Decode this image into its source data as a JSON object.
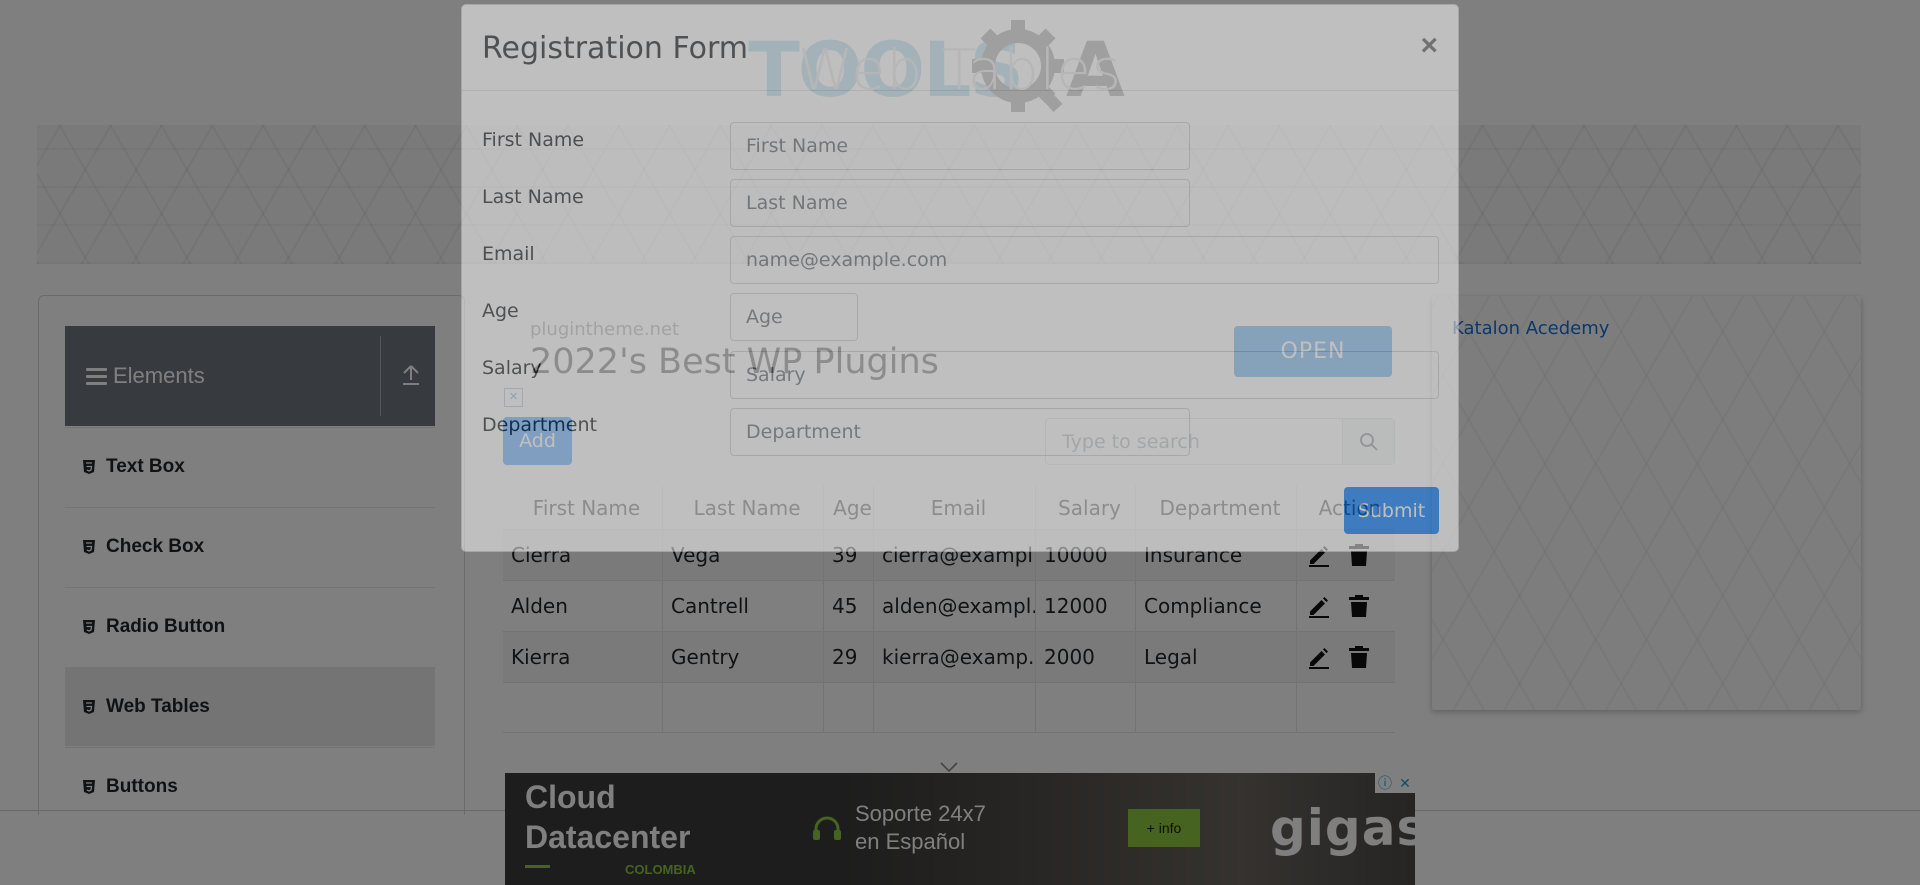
{
  "page": {
    "main_header": "Web Tables"
  },
  "sidebar": {
    "group_title": "Elements",
    "items": [
      {
        "label": "Text Box"
      },
      {
        "label": "Check Box"
      },
      {
        "label": "Radio Button"
      },
      {
        "label": "Web Tables"
      },
      {
        "label": "Buttons"
      }
    ]
  },
  "ad_top": {
    "site": "plugintheme.net",
    "title": "2022's Best WP Plugins",
    "open_label": "OPEN",
    "choices_icon": "×"
  },
  "toolbar": {
    "add_label": "Add",
    "search_placeholder": "Type to search"
  },
  "table": {
    "headers": [
      "First Name",
      "Last Name",
      "Age",
      "Email",
      "Salary",
      "Department",
      "Action"
    ],
    "rows": [
      [
        "Cierra",
        "Vega",
        "39",
        "cierra@exampl...",
        "10000",
        "Insurance"
      ],
      [
        "Alden",
        "Cantrell",
        "45",
        "alden@exampl...",
        "12000",
        "Compliance"
      ],
      [
        "Kierra",
        "Gentry",
        "29",
        "kierra@examp...",
        "2000",
        "Legal"
      ]
    ]
  },
  "right_ad": {
    "alt_text": "Katalon Acedemy"
  },
  "bottom_ad": {
    "title_line1": "Cloud",
    "title_line2": "Datacenter",
    "country": "COLOMBIA",
    "support_line1": "Soporte 24x7",
    "support_line2": "en Español",
    "info_label": "+ info",
    "brand": "gigas",
    "info_icon": "ⓘ",
    "close_icon": "✕"
  },
  "modal": {
    "title": "Registration Form",
    "close_symbol": "×",
    "fields": {
      "first_name": {
        "label": "First Name",
        "placeholder": "First Name"
      },
      "last_name": {
        "label": "Last Name",
        "placeholder": "Last Name"
      },
      "email": {
        "label": "Email",
        "placeholder": "name@example.com"
      },
      "age": {
        "label": "Age",
        "placeholder": "Age"
      },
      "salary": {
        "label": "Salary",
        "placeholder": "Salary"
      },
      "department": {
        "label": "Department",
        "placeholder": "Department"
      }
    },
    "submit_label": "Submit"
  },
  "colors": {
    "primary": "#007bff",
    "sidebar_header": "#6f757c",
    "ad_accent": "#8cc63f",
    "logo_blue": "#8ecae6",
    "logo_gray": "#7d7d7d"
  },
  "icons": {
    "menu": "hamburger-icon",
    "collapse": "upload-arrow-icon",
    "item": "html5-icon",
    "search": "search-icon",
    "edit": "pencil-icon",
    "delete": "trash-icon",
    "expand": "chevron-down-icon"
  }
}
